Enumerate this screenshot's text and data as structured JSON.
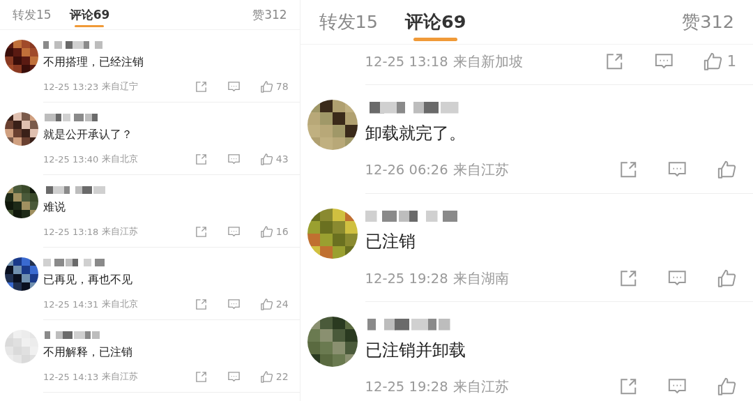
{
  "panels": [
    {
      "tabs": [
        {
          "label": "转发15",
          "selected": false
        },
        {
          "label": "评论69",
          "selected": true
        }
      ],
      "likes": "赞312",
      "comments": [
        {
          "text": "不用搭理，已经注销",
          "time": "12-25 13:23",
          "location": "来自辽宁",
          "like_count": "78"
        },
        {
          "text": "就是公开承认了？",
          "time": "12-25 13:40",
          "location": "来自北京",
          "like_count": "43"
        },
        {
          "text": "难说",
          "time": "12-25 13:18",
          "location": "来自江苏",
          "like_count": "16"
        },
        {
          "text": "已再见，再也不见",
          "time": "12-25 14:31",
          "location": "来自北京",
          "like_count": "24"
        },
        {
          "text": "不用解释，已注销",
          "time": "12-25 14:13",
          "location": "来自江苏",
          "like_count": "22"
        }
      ]
    },
    {
      "tabs": [
        {
          "label": "转发15",
          "selected": false
        },
        {
          "label": "评论69",
          "selected": true
        }
      ],
      "likes": "赞312",
      "comments": [
        {
          "time": "12-25 13:18",
          "location": "来自新加坡",
          "like_count": "1"
        },
        {
          "text": "卸载就完了。",
          "time": "12-26 06:26",
          "location": "来自江苏"
        },
        {
          "text": "已注销",
          "time": "12-25 19:28",
          "location": "来自湖南"
        },
        {
          "text": "已注销并卸载",
          "time": "12-25 19:28",
          "location": "来自江苏"
        }
      ]
    }
  ]
}
